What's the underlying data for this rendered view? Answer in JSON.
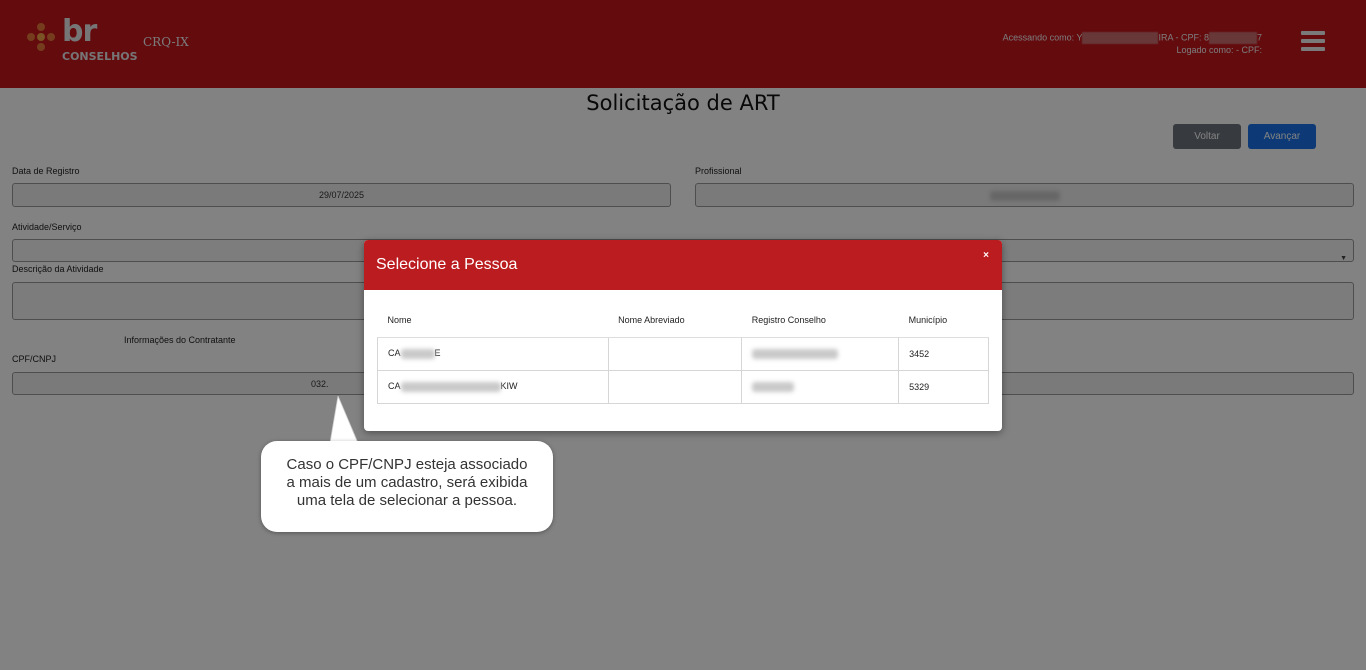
{
  "header": {
    "logo_text": "br",
    "logo_sub": "CONSELHOS",
    "app_name": "CRQ-IX",
    "user_prefix": "Acessando como: Y",
    "user_suffix": "IRA - CPF: 8",
    "user_end": "7",
    "logged_as": "Logado como: - CPF:",
    "menu_icon": "hamburger-icon"
  },
  "page": {
    "title": "Solicitação de ART",
    "back_label": "Voltar",
    "next_label": "Avançar"
  },
  "form": {
    "data_registro_label": "Data de Registro",
    "data_registro_value": "29/07/2025",
    "profissional_label": "Profissional",
    "atividade_label": "Atividade/Serviço",
    "descricao_label": "Descrição da Atividade",
    "contratante_label": "Informações do Contratante",
    "cpf_label": "CPF/CNPJ",
    "cpf_value": "032."
  },
  "modal": {
    "title": "Selecione a Pessoa",
    "close": "×",
    "columns": [
      "Nome",
      "Nome Abreviado",
      "Registro Conselho",
      "Município"
    ],
    "rows": [
      {
        "nome_start": "CA",
        "nome_end": "E",
        "nome_abreviado": "",
        "municipio": "3452"
      },
      {
        "nome_start": "CA",
        "nome_end": "KIW",
        "nome_abreviado": "",
        "municipio": "5329"
      }
    ]
  },
  "callout": {
    "line1": "Caso o CPF/CNPJ esteja associado",
    "line2": "a mais de um cadastro, será exibida",
    "line3": "uma tela de selecionar a pessoa."
  },
  "colors": {
    "header": "#c4161c",
    "modal_header": "#bb1c1f",
    "primary": "#1a73e8",
    "secondary": "#6c757d"
  }
}
